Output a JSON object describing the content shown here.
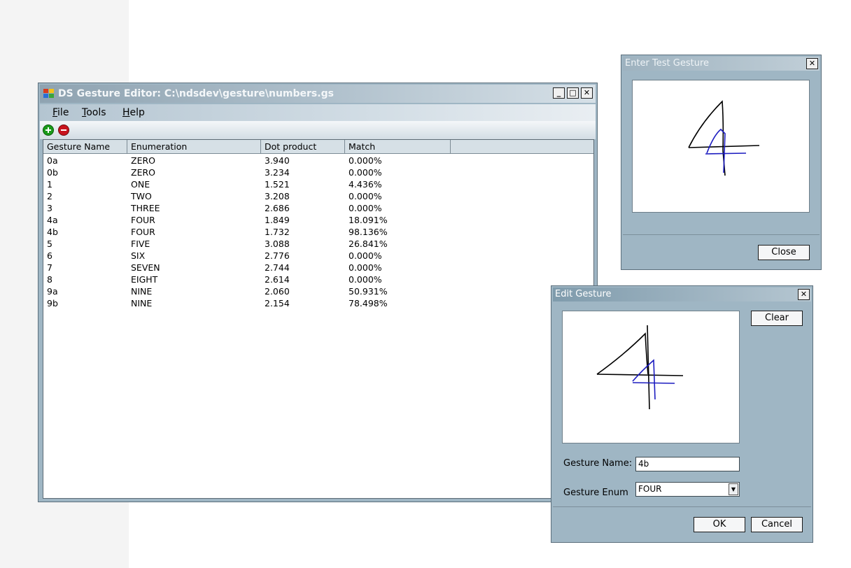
{
  "main_window": {
    "title": "DS Gesture Editor: C:\\ndsdev\\gesture\\numbers.gs",
    "menu": [
      {
        "label": "File",
        "mnemonic": "F",
        "rest": "ile"
      },
      {
        "label": "Tools",
        "mnemonic": "T",
        "rest": "ools"
      },
      {
        "label": "Help",
        "mnemonic": "H",
        "rest": "elp"
      }
    ],
    "toolbar": {
      "add_icon": "plus-circle-icon",
      "remove_icon": "minus-circle-icon",
      "add_color": "#1a9a1a",
      "remove_color": "#c8141e"
    },
    "columns": [
      "Gesture Name",
      "Enumeration",
      "Dot product",
      "Match"
    ],
    "rows": [
      [
        "0a",
        "ZERO",
        "3.940",
        "0.000%"
      ],
      [
        "0b",
        "ZERO",
        "3.234",
        "0.000%"
      ],
      [
        "1",
        "ONE",
        "1.521",
        "4.436%"
      ],
      [
        "2",
        "TWO",
        "3.208",
        "0.000%"
      ],
      [
        "3",
        "THREE",
        "2.686",
        "0.000%"
      ],
      [
        "4a",
        "FOUR",
        "1.849",
        "18.091%"
      ],
      [
        "4b",
        "FOUR",
        "1.732",
        "98.136%"
      ],
      [
        "5",
        "FIVE",
        "3.088",
        "26.841%"
      ],
      [
        "6",
        "SIX",
        "2.776",
        "0.000%"
      ],
      [
        "7",
        "SEVEN",
        "2.744",
        "0.000%"
      ],
      [
        "8",
        "EIGHT",
        "2.614",
        "0.000%"
      ],
      [
        "9a",
        "NINE",
        "2.060",
        "50.931%"
      ],
      [
        "9b",
        "NINE",
        "2.154",
        "78.498%"
      ]
    ],
    "buttons": {
      "minimize": "_",
      "maximize": "□",
      "close": "✕"
    }
  },
  "test_window": {
    "title": "Enter Test Gesture",
    "close_button": "Close",
    "close_x": "✕"
  },
  "edit_window": {
    "title": "Edit Gesture",
    "clear_button": "Clear",
    "name_label": "Gesture Name:",
    "name_value": "4b",
    "enum_label": "Gesture Enum",
    "enum_value": "FOUR",
    "ok_button": "OK",
    "cancel_button": "Cancel",
    "close_x": "✕"
  },
  "colors": {
    "stroke_black": "#000000",
    "stroke_blue": "#1c1cc0",
    "window_body": "#9fb6c4"
  }
}
